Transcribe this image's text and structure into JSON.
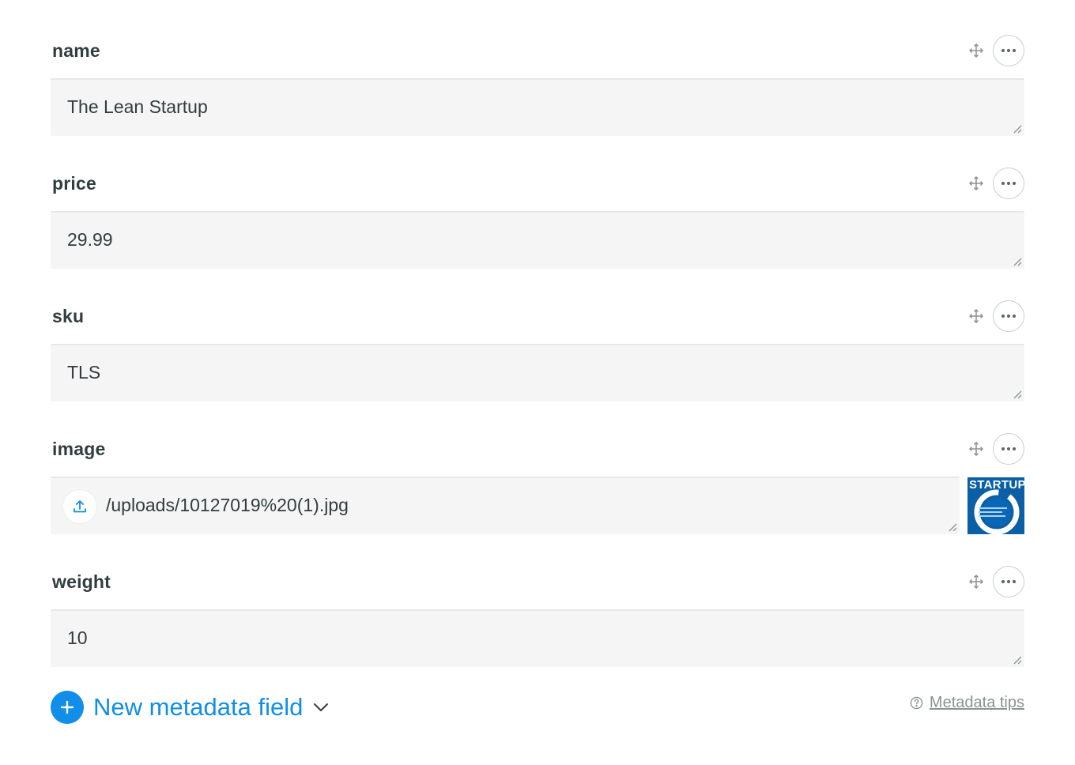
{
  "fields": [
    {
      "label": "name",
      "value": "The Lean Startup"
    },
    {
      "label": "price",
      "value": "29.99"
    },
    {
      "label": "sku",
      "value": "TLS"
    },
    {
      "label": "image",
      "value": "/uploads/10127019%20(1).jpg",
      "thumbnail_text": "STARTUP"
    },
    {
      "label": "weight",
      "value": "10"
    }
  ],
  "footer": {
    "new_field_label": "New metadata field",
    "tips_label": "Metadata tips"
  },
  "colors": {
    "accent": "#108ee9",
    "thumbnail_bg": "#0b5fa5",
    "input_bg": "#f5f5f5"
  },
  "icons": {
    "move": "move-icon",
    "more": "more-options-icon",
    "upload": "upload-icon",
    "plus": "plus-icon",
    "chevron": "chevron-down-icon",
    "help": "question-circle-icon"
  }
}
